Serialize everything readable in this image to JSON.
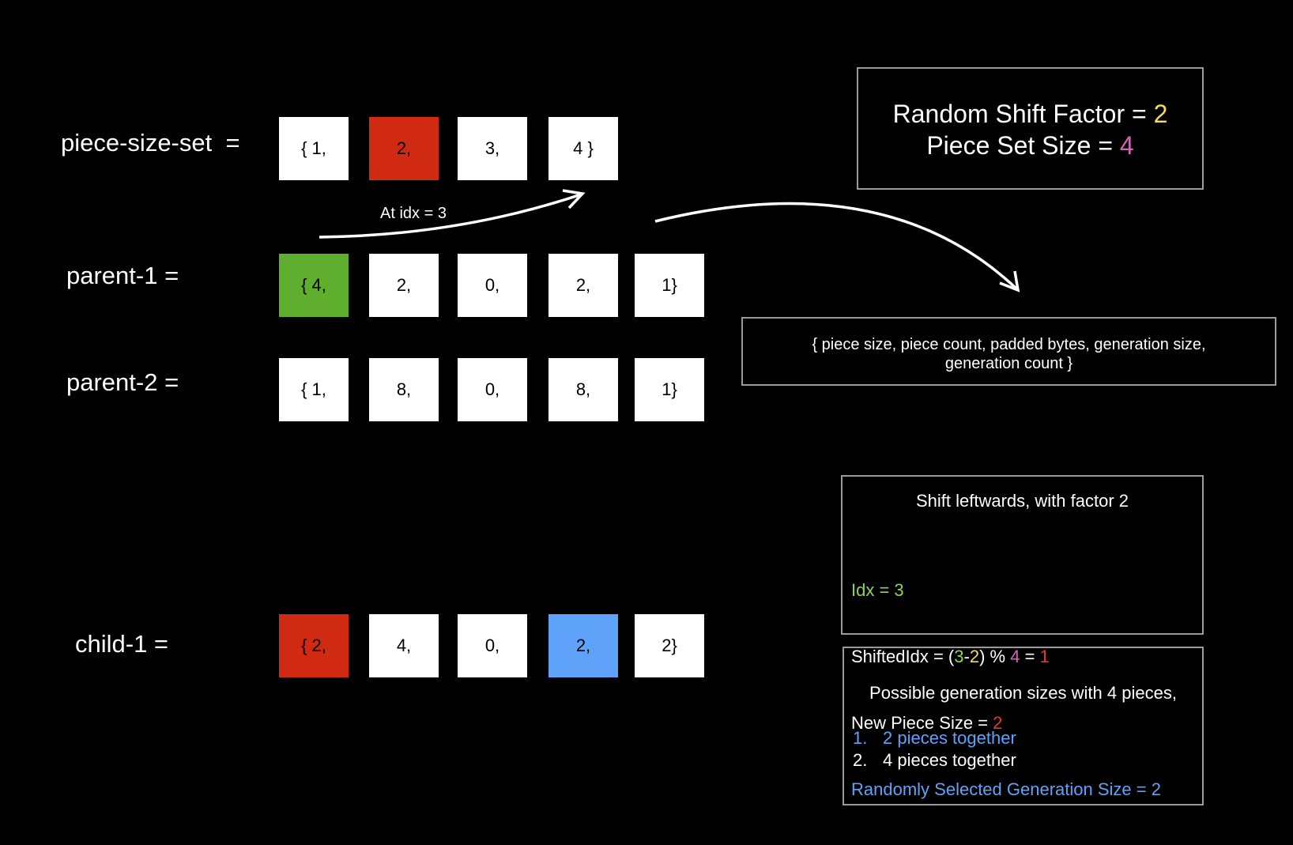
{
  "rows": {
    "piece_size_set": {
      "label": "piece-size-set  =",
      "cells": [
        "{ 1,",
        "2,",
        "3,",
        "4 }"
      ]
    },
    "parent_1": {
      "label": "parent-1 =",
      "cells": [
        "{ 4,",
        "2,",
        "0,",
        "2,",
        "1}"
      ]
    },
    "parent_2": {
      "label": "parent-2 =",
      "cells": [
        "{ 1,",
        "8,",
        "0,",
        "8,",
        "1}"
      ]
    },
    "child_1": {
      "label": "child-1 =",
      "cells": [
        "{ 2,",
        "4,",
        "0,",
        "2,",
        "2}"
      ]
    }
  },
  "colors": {
    "red": "#d12a13",
    "green": "#5fae2d",
    "blue": "#5ea2fa",
    "yellow": "#f4dc60",
    "pink": "#d565b4"
  },
  "arrow_label": "At idx = 3",
  "info_box": {
    "line1_prefix": "Random Shift Factor = ",
    "line1_value": "2",
    "line2_prefix": "Piece Set Size = ",
    "line2_value": "4"
  },
  "tuple_box": {
    "line1": "{ piece size, piece count, padded bytes, generation size,",
    "line2": "generation count }"
  },
  "shift_box": {
    "title": "Shift leftwards, with factor 2",
    "idx_line": "Idx = 3",
    "shifted_prefix": "ShiftedIdx = (",
    "shifted_a": "3",
    "shifted_dash": "-",
    "shifted_b": "2",
    "shifted_mid": ") % ",
    "shifted_mod": "4",
    "shifted_eq": " = ",
    "shifted_result": "1",
    "new_size_prefix": "New Piece Size = ",
    "new_size_value": "2",
    "random_line": "Randomly Selected Generation Size = 2"
  },
  "gen_box": {
    "title": "Possible generation sizes with 4 pieces,",
    "items": [
      {
        "num": "1.",
        "text": "2 pieces together"
      },
      {
        "num": "2.",
        "text": "4 pieces together"
      }
    ]
  }
}
